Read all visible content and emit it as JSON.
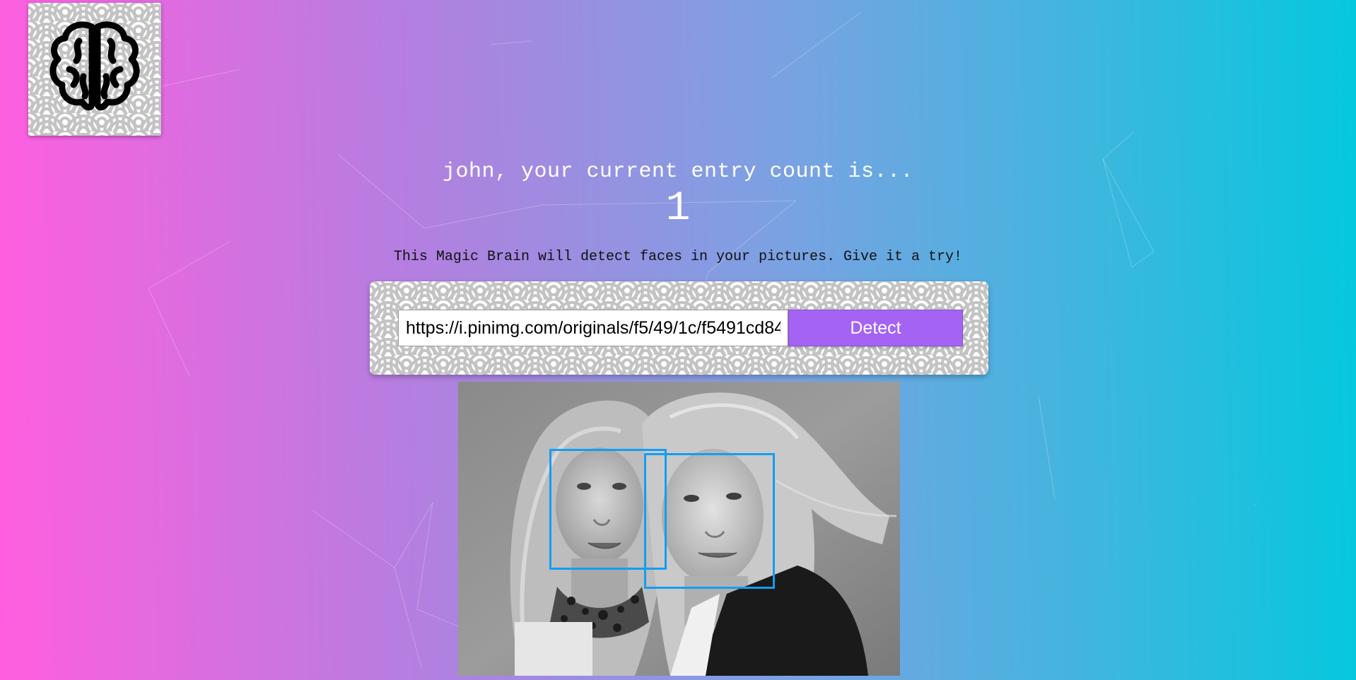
{
  "logo": {
    "icon": "brain-icon"
  },
  "rank": {
    "title": "john, your current entry count is...",
    "count": "1"
  },
  "tagline": "This Magic Brain will detect faces in your pictures. Give it a try!",
  "form": {
    "url_value": "https://i.pinimg.com/originals/f5/49/1c/f5491cd84",
    "detect_label": "Detect"
  },
  "colors": {
    "gradient_start": "#ff5edf",
    "gradient_end": "#04c8de",
    "button": "#a463f2",
    "face_box": "#149df2"
  },
  "result": {
    "detected_faces": 2
  }
}
